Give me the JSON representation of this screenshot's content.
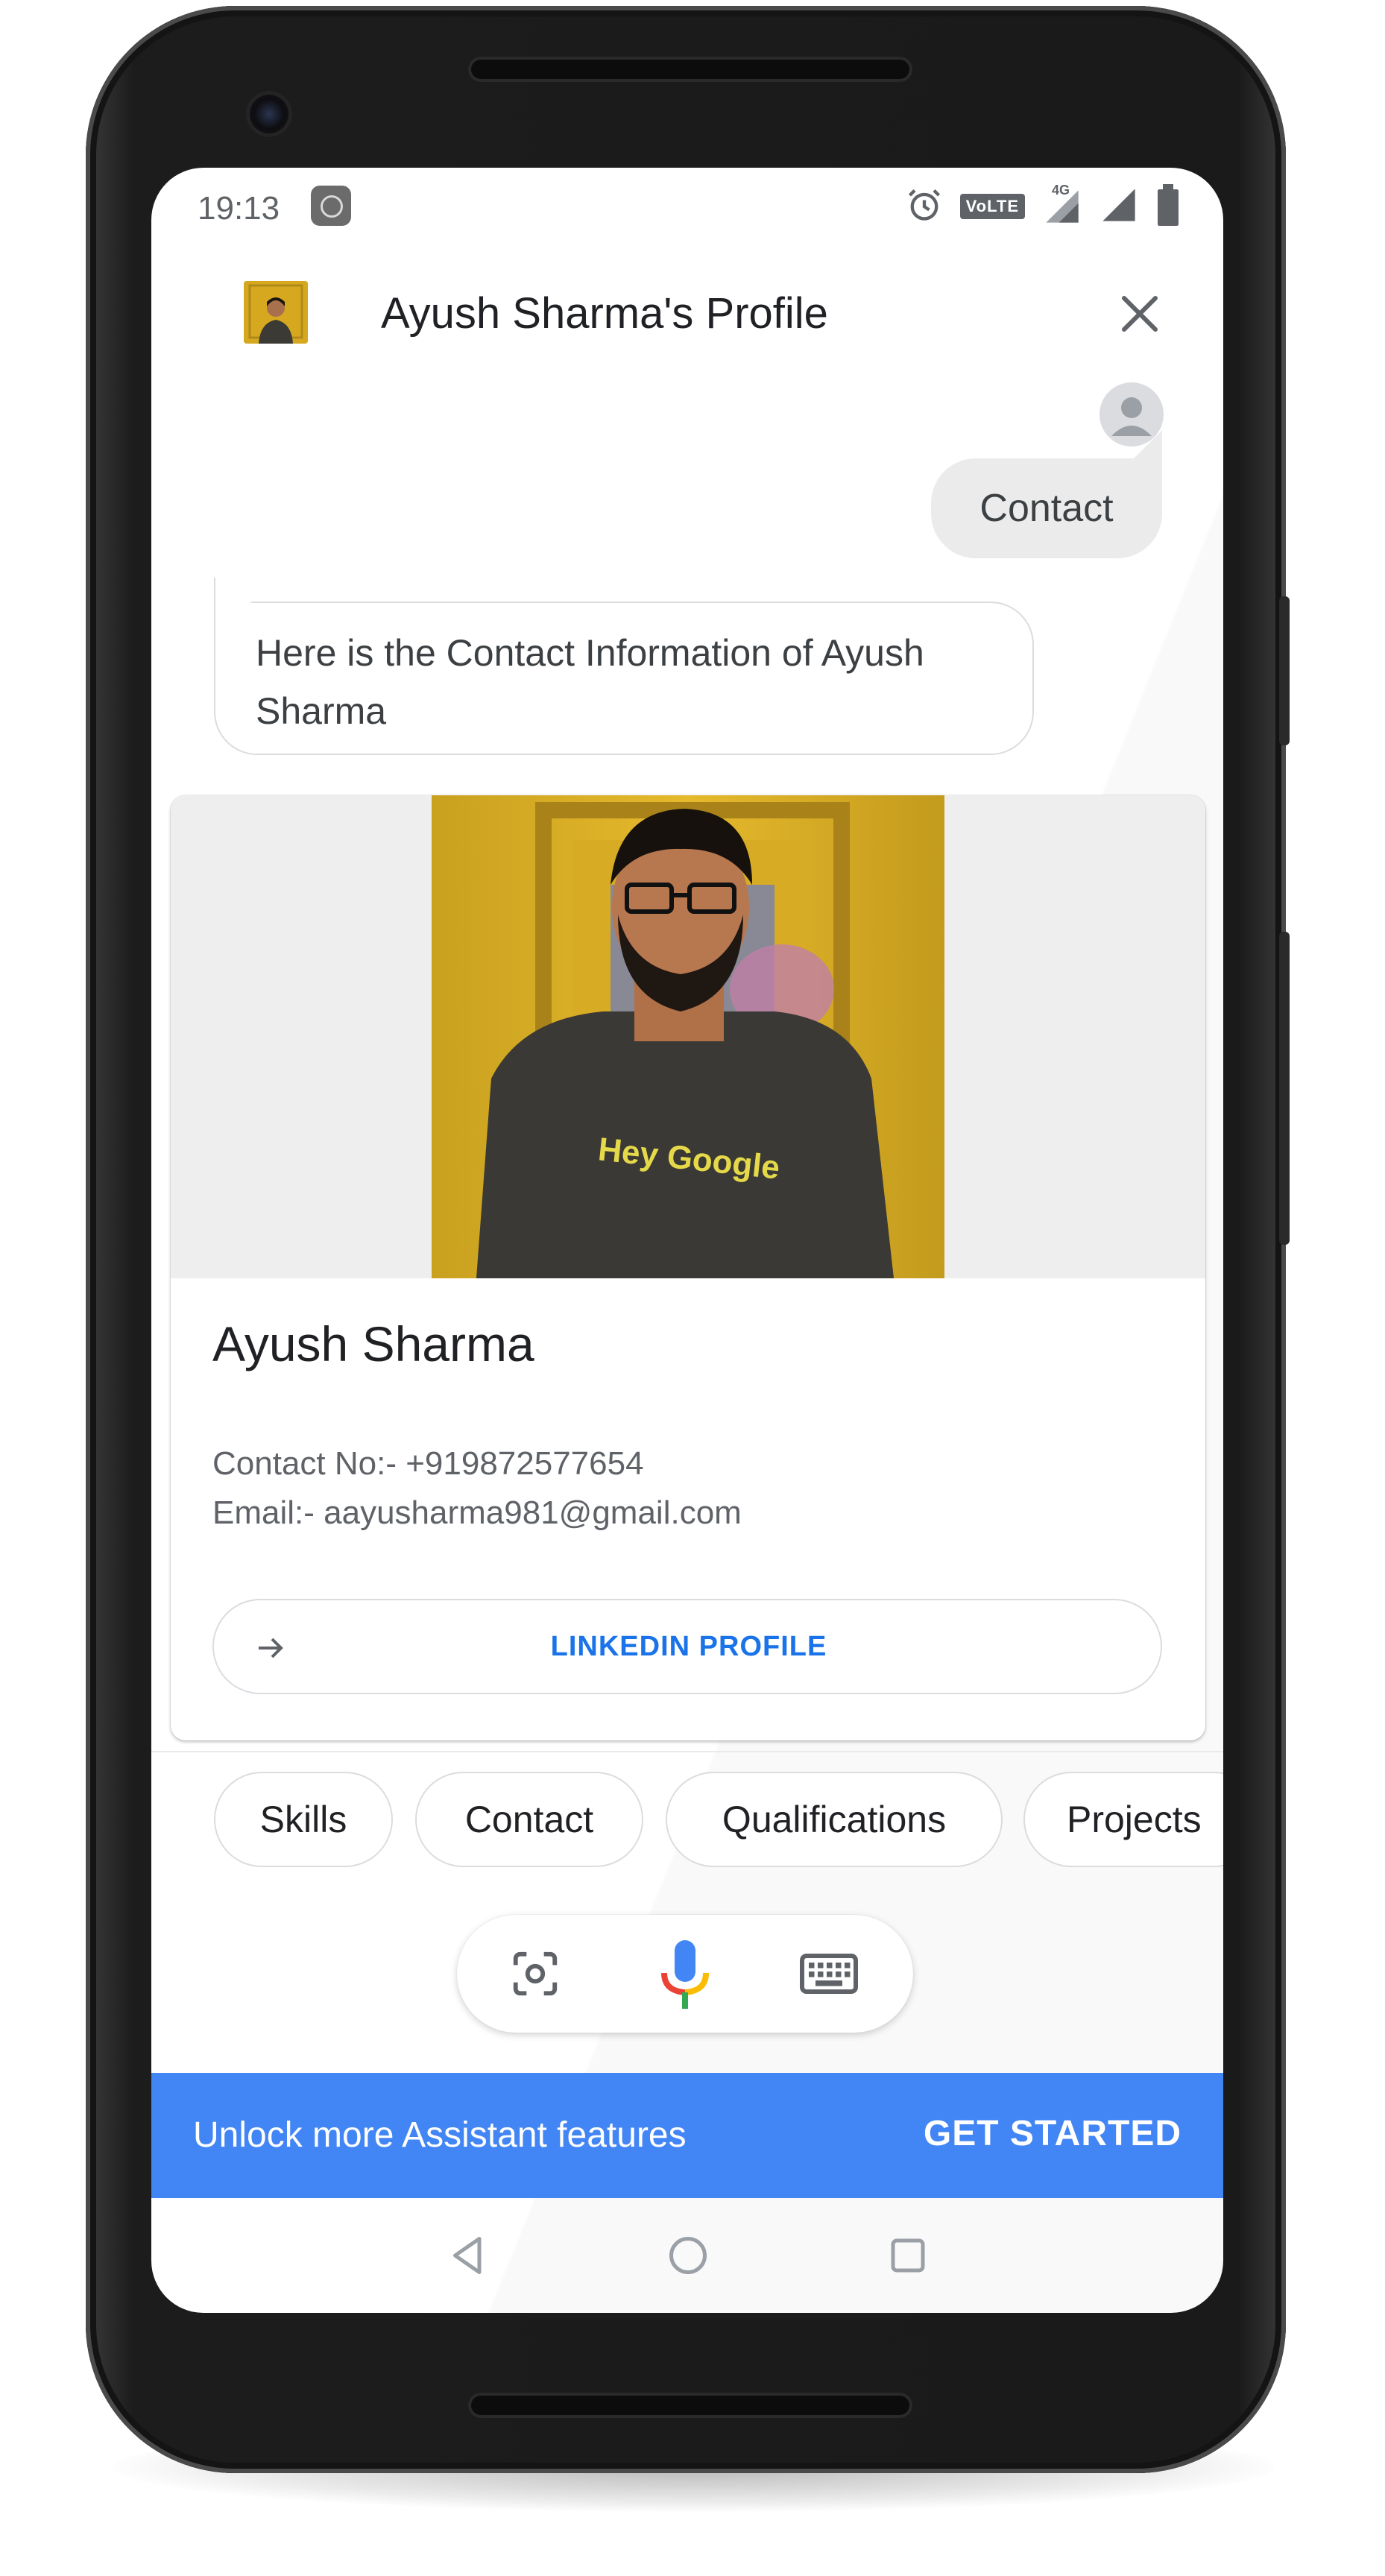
{
  "status_bar": {
    "time": "19:13",
    "volte_label": "VoLTE",
    "network_label": "4G",
    "icons": [
      "alarm-icon",
      "volte-icon",
      "signal-4g-icon",
      "signal-icon",
      "battery-icon"
    ]
  },
  "header": {
    "title": "Ayush Sharma's Profile",
    "avatar_icon": "profile-avatar",
    "close_icon": "close-icon"
  },
  "conversation": {
    "user_message": "Contact",
    "assistant_message": "Here is the Contact Information of Ayush Sharma"
  },
  "card": {
    "photo_text": "Hey Google",
    "name": "Ayush Sharma",
    "contact_line": "Contact No:- +919872577654",
    "email_line": "Email:- aayusharma981@gmail.com",
    "link_label": "LINKEDIN PROFILE"
  },
  "suggestions": [
    "Skills",
    "Contact",
    "Qualifications",
    "Projects"
  ],
  "input_bar": {
    "icons": [
      "lens-icon",
      "mic-icon",
      "keyboard-icon"
    ]
  },
  "banner": {
    "text": "Unlock more Assistant features",
    "button": "GET STARTED",
    "color": "#4285f4"
  },
  "nav_bar": {
    "icons": [
      "back-icon",
      "home-icon",
      "recents-icon"
    ]
  },
  "colors": {
    "accent": "#1a73e8",
    "text_primary": "#202124",
    "text_secondary": "#5f6368",
    "mic_blue": "#4285f4",
    "mic_red": "#ea4335",
    "mic_yellow": "#fbbc04",
    "mic_green": "#34a853"
  }
}
